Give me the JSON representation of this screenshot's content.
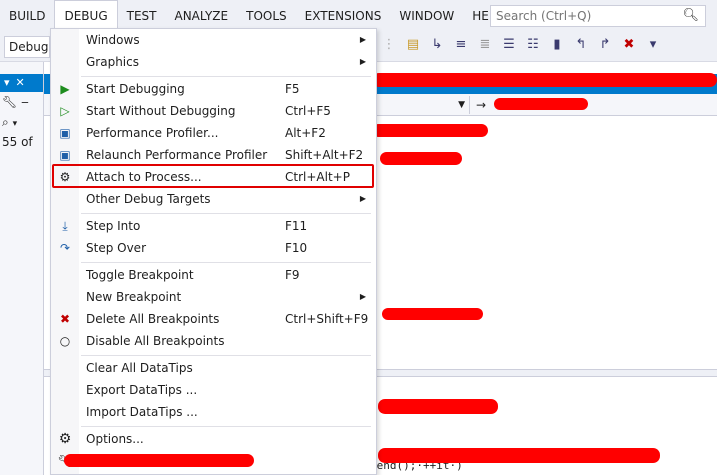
{
  "menubar": {
    "items": [
      "BUILD",
      "DEBUG",
      "TEST",
      "ANALYZE",
      "TOOLS",
      "EXTENSIONS",
      "WINDOW",
      "HELP"
    ],
    "active_index": 1,
    "search_placeholder": "Search (Ctrl+Q)"
  },
  "toolbar": {
    "config_value": "Debug"
  },
  "leftpane": {
    "row_text": "55 of"
  },
  "editor": {
    "code_snippet": ".end();·++it·)"
  },
  "debug_menu": {
    "items": [
      {
        "label": "Windows",
        "shortcut": "",
        "submenu": true,
        "icon": ""
      },
      {
        "label": "Graphics",
        "shortcut": "",
        "submenu": true,
        "icon": ""
      },
      {
        "label": "Start Debugging",
        "shortcut": "F5",
        "submenu": false,
        "icon": "play-icon"
      },
      {
        "label": "Start Without Debugging",
        "shortcut": "Ctrl+F5",
        "submenu": false,
        "icon": "play-outline-icon"
      },
      {
        "label": "Performance Profiler...",
        "shortcut": "Alt+F2",
        "submenu": false,
        "icon": "profiler-icon"
      },
      {
        "label": "Relaunch Performance Profiler",
        "shortcut": "Shift+Alt+F2",
        "submenu": false,
        "icon": "relaunch-profiler-icon"
      },
      {
        "label": "Attach to Process...",
        "shortcut": "Ctrl+Alt+P",
        "submenu": false,
        "icon": "attach-gears-icon"
      },
      {
        "label": "Other Debug Targets",
        "shortcut": "",
        "submenu": true,
        "icon": ""
      },
      {
        "label": "Step Into",
        "shortcut": "F11",
        "submenu": false,
        "icon": "step-into-icon"
      },
      {
        "label": "Step Over",
        "shortcut": "F10",
        "submenu": false,
        "icon": "step-over-icon"
      },
      {
        "label": "Toggle Breakpoint",
        "shortcut": "F9",
        "submenu": false,
        "icon": ""
      },
      {
        "label": "New Breakpoint",
        "shortcut": "",
        "submenu": true,
        "icon": ""
      },
      {
        "label": "Delete All Breakpoints",
        "shortcut": "Ctrl+Shift+F9",
        "submenu": false,
        "icon": "delete-breakpoints-icon"
      },
      {
        "label": "Disable All Breakpoints",
        "shortcut": "",
        "submenu": false,
        "icon": "disable-breakpoints-icon"
      },
      {
        "label": "Clear All DataTips",
        "shortcut": "",
        "submenu": false,
        "icon": ""
      },
      {
        "label": "Export DataTips ...",
        "shortcut": "",
        "submenu": false,
        "icon": ""
      },
      {
        "label": "Import DataTips ...",
        "shortcut": "",
        "submenu": false,
        "icon": ""
      },
      {
        "label": "Options...",
        "shortcut": "",
        "submenu": false,
        "icon": "gear-icon"
      }
    ],
    "highlighted_label": "Attach to Process..."
  },
  "colors": {
    "accent": "#007acc",
    "highlight_border": "#e00000",
    "redaction": "#ff0000"
  }
}
